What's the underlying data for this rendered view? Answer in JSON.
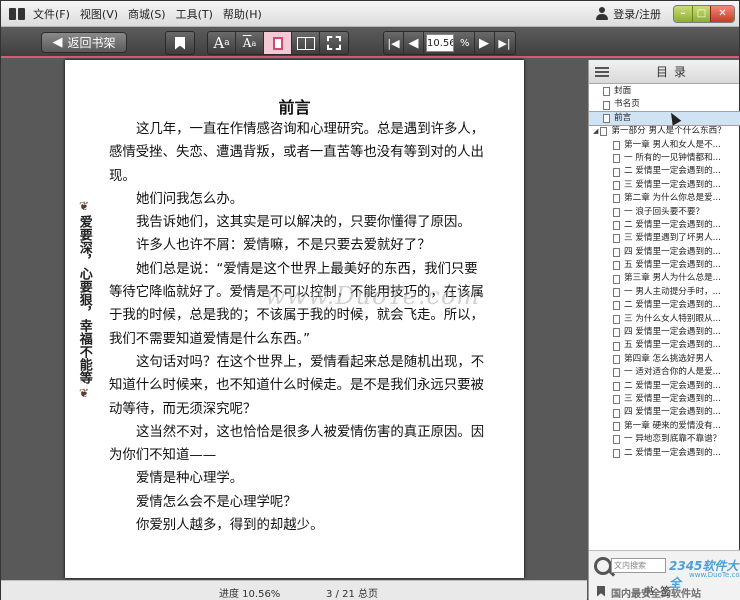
{
  "menu": {
    "items": [
      "文件(F)",
      "视图(V)",
      "商城(S)",
      "工具(T)",
      "帮助(H)"
    ],
    "login": "登录/注册"
  },
  "toolbar": {
    "back_label": "返回书架",
    "font_larger": "A",
    "font_smaller": "A",
    "page_value": "10.56",
    "percent": "%"
  },
  "page": {
    "title": "前言",
    "side_banner": "爱要深，心要狠，幸福不能等",
    "paragraphs": [
      "这几年，一直在作情感咨询和心理研究。总是遇到许多人，感情受挫、失恋、遭遇背叛，或者一直苦等也没有等到对的人出现。",
      "她们问我怎么办。",
      "我告诉她们，这其实是可以解决的，只要你懂得了原因。",
      "许多人也许不屑：爱情嘛，不是只要去爱就好了？",
      "她们总是说：“爱情是这个世界上最美好的东西，我们只要等待它降临就好了。爱情是不可以控制，不能用技巧的，在该属于我的时候，总是我的；不该属于我的时候，就会飞走。所以，我们不需要知道爱情是什么东西。”",
      "这句话对吗？在这个世界上，爱情看起来总是随机出现，不知道什么时候来，也不知道什么时候走。是不是我们永远只要被动等待，而无须深究呢？",
      "这当然不对，这也恰恰是很多人被爱情伤害的真正原因。因为你们不知道——",
      "爱情是种心理学。",
      "爱情怎么会不是心理学呢？",
      "你爱别人越多，得到的却越少。"
    ],
    "watermark": "www.DuoTe.com"
  },
  "status": {
    "progress": "进度 10.56%",
    "pages": "3 / 21 总页"
  },
  "toc": {
    "title": "目录",
    "items": [
      {
        "label": "封面",
        "kind": "doc",
        "level": 1
      },
      {
        "label": "书名页",
        "kind": "doc",
        "level": 1
      },
      {
        "label": "前言",
        "kind": "doc",
        "level": 1,
        "selected": true
      },
      {
        "label": "第一部分  男人是个什么东西？",
        "kind": "folder",
        "level": 0
      },
      {
        "label": "第一章  男人和女人是不...",
        "kind": "doc",
        "level": 2
      },
      {
        "label": "一  所有的一见钟情都和...",
        "kind": "doc",
        "level": 2
      },
      {
        "label": "二  爱情里一定会遇到的...",
        "kind": "doc",
        "level": 2
      },
      {
        "label": "三  爱情里一定会遇到的...",
        "kind": "doc",
        "level": 2
      },
      {
        "label": "第二章  为什么你总是爱...",
        "kind": "doc",
        "level": 2
      },
      {
        "label": "一  浪子回头要不要？",
        "kind": "doc",
        "level": 2
      },
      {
        "label": "二  爱情里一定会遇到的...",
        "kind": "doc",
        "level": 2
      },
      {
        "label": "三  爱情里遇到了坏男人...",
        "kind": "doc",
        "level": 2
      },
      {
        "label": "四  爱情里一定会遇到的...",
        "kind": "doc",
        "level": 2
      },
      {
        "label": "五  爱情里一定会遇到的...",
        "kind": "doc",
        "level": 2
      },
      {
        "label": "第三章  男人为什么总是...",
        "kind": "doc",
        "level": 2
      },
      {
        "label": "一  男人主动提分手时，...",
        "kind": "doc",
        "level": 2
      },
      {
        "label": "二  爱情里一定会遇到的...",
        "kind": "doc",
        "level": 2
      },
      {
        "label": "三  为什么女人特别眼从...",
        "kind": "doc",
        "level": 2
      },
      {
        "label": "四  爱情里一定会遇到的...",
        "kind": "doc",
        "level": 2
      },
      {
        "label": "五  爱情里一定会遇到的...",
        "kind": "doc",
        "level": 2
      },
      {
        "label": "第四章  怎么挑选好男人",
        "kind": "doc",
        "level": 2
      },
      {
        "label": "一  适对适合你的人是爱...",
        "kind": "doc",
        "level": 2
      },
      {
        "label": "二  爱情里一定会遇到的...",
        "kind": "doc",
        "level": 2
      },
      {
        "label": "三  爱情里一定会遇到的...",
        "kind": "doc",
        "level": 2
      },
      {
        "label": "四  爱情里一定会遇到的...",
        "kind": "doc",
        "level": 2
      },
      {
        "label": "第一章  硬来的爱情没有...",
        "kind": "doc",
        "level": 2
      },
      {
        "label": "一  异地恋到底靠不靠谱？",
        "kind": "doc",
        "level": 2
      },
      {
        "label": "二  爱情里一定会遇到的...",
        "kind": "doc",
        "level": 2
      }
    ],
    "search_placeholder": "文内搜索",
    "bookmark_label": "书签",
    "watermark_brand": "2345软件大全",
    "watermark_url": "www.DuoTe.com",
    "watermark_slogan": "国内最安全的软件站"
  }
}
